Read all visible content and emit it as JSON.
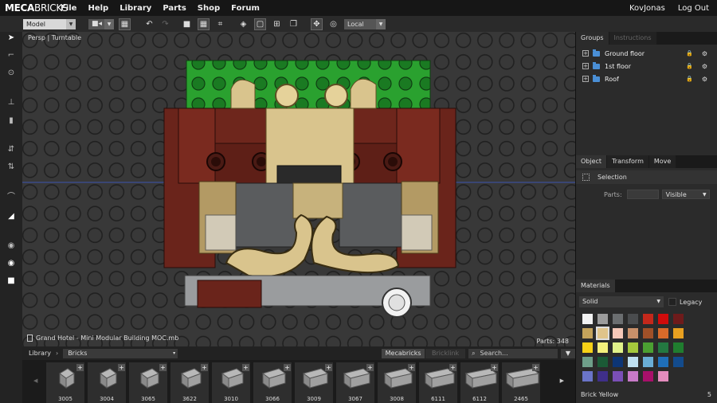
{
  "app": {
    "logo_bold": "MECA",
    "logo_light": "BRICKS"
  },
  "menu": [
    "File",
    "Help",
    "Library",
    "Parts",
    "Shop",
    "Forum"
  ],
  "user": {
    "name": "KovJonas",
    "logout": "Log Out"
  },
  "toolbar": {
    "mode_select": "Model",
    "space_select": "Local"
  },
  "viewport": {
    "label": "Persp | Turntable",
    "file_name": "Grand Hotel - Mini Modular Building MOC.mb",
    "parts_count": "Parts: 348"
  },
  "groups_panel": {
    "tabs": [
      "Groups",
      "Instructions"
    ],
    "items": [
      {
        "label": "Ground floor"
      },
      {
        "label": "1st floor"
      },
      {
        "label": "Roof"
      }
    ]
  },
  "object_panel": {
    "tabs": [
      "Object",
      "Transform",
      "Move"
    ],
    "selection_label": "Selection",
    "parts_label": "Parts:",
    "parts_value": "",
    "visibility": "Visible"
  },
  "materials_panel": {
    "tab": "Materials",
    "material_type": "Solid",
    "legacy_label": "Legacy",
    "selected_color_name": "Brick Yellow",
    "selected_color_count": "5",
    "colors": [
      "#f2f2f2",
      "#9c9c9c",
      "#6b6e70",
      "#4a4c4e",
      "#c4281b",
      "#d00b0b",
      "#6e1b1b",
      "#c4a35b",
      "#e0c48a",
      "#f5c8b8",
      "#c8906a",
      "#a05028",
      "#d86a2a",
      "#e8a020",
      "#f7d117",
      "#f4f07c",
      "#e1f28a",
      "#a5c83c",
      "#4b9f32",
      "#237841",
      "#207d2f",
      "#6f9f8a",
      "#1b5a36",
      "#0d3575",
      "#bfe0f0",
      "#6aaed6",
      "#1f6fb8",
      "#134b8c",
      "#6a74c8",
      "#3f2f8a",
      "#7a4fb6",
      "#c87ac8",
      "#a8106a",
      "#e48cbe"
    ],
    "selected_index": 8
  },
  "library": {
    "label": "Library",
    "category": "Bricks",
    "source_tabs": [
      "Mecabricks",
      "Bricklink"
    ],
    "search_placeholder": "Search...",
    "parts": [
      "3005",
      "3004",
      "3065",
      "3622",
      "3010",
      "3066",
      "3009",
      "3067",
      "3008",
      "6111",
      "6112",
      "2465"
    ]
  }
}
